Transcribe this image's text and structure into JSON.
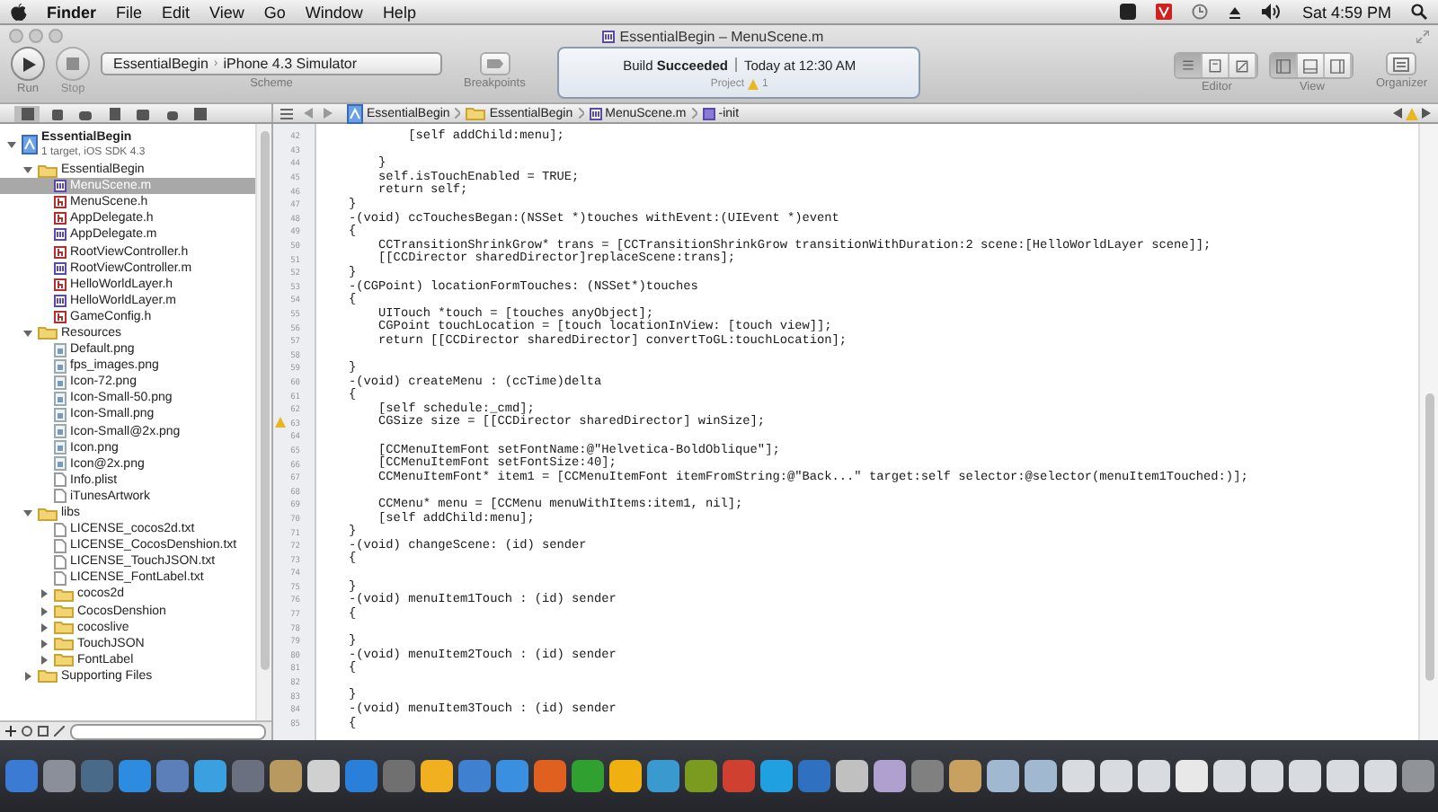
{
  "menu_bar": {
    "items": [
      {
        "label": "Finder",
        "bold": true
      },
      {
        "label": "File",
        "bold": false
      },
      {
        "label": "Edit",
        "bold": false
      },
      {
        "label": "View",
        "bold": false
      },
      {
        "label": "Go",
        "bold": false
      },
      {
        "label": "Window",
        "bold": false
      },
      {
        "label": "Help",
        "bold": false
      }
    ],
    "clock": "Sat 4:59 PM"
  },
  "window": {
    "title": "EssentialBegin – MenuScene.m"
  },
  "toolbar": {
    "run_label": "Run",
    "stop_label": "Stop",
    "stop_disabled": true,
    "scheme": {
      "project": "EssentialBegin",
      "separator": "›",
      "destination": "iPhone 4.3 Simulator",
      "label": "Scheme"
    },
    "breakpoints_label": "Breakpoints",
    "activity": {
      "status_prefix": "Build",
      "status": "Succeeded",
      "time": "Today at 12:30 AM",
      "project": "Project",
      "warnings": "1"
    },
    "editor": {
      "label": "Editor",
      "buttons": [
        {
          "selected": true
        },
        {
          "selected": false
        },
        {
          "selected": false
        }
      ]
    },
    "view": {
      "label": "View",
      "buttons": [
        {
          "selected": true
        },
        {
          "selected": false
        },
        {
          "selected": false
        }
      ]
    },
    "organizer_label": "Organizer"
  },
  "navigator_tabs": [
    {
      "selected": true
    },
    {
      "selected": false
    },
    {
      "selected": false
    },
    {
      "selected": false
    },
    {
      "selected": false
    },
    {
      "selected": false
    },
    {
      "selected": false
    }
  ],
  "jump_bar": {
    "crumbs": [
      {
        "label": "EssentialBegin",
        "kind": "project"
      },
      {
        "label": "EssentialBegin",
        "kind": "folder"
      },
      {
        "label": "MenuScene.m",
        "kind": "source"
      },
      {
        "label": "-init",
        "kind": "method"
      }
    ]
  },
  "navigator": {
    "items": [
      {
        "label": "EssentialBegin",
        "subtitle": "1 target, iOS SDK 4.3",
        "kind": "project",
        "selected": false,
        "expanded": true,
        "children": [
          {
            "label": "EssentialBegin",
            "kind": "folder",
            "selected": false,
            "expanded": true,
            "children": [
              {
                "label": "MenuScene.m",
                "kind": "source",
                "selected": true
              },
              {
                "label": "MenuScene.h",
                "kind": "header",
                "selected": false
              },
              {
                "label": "AppDelegate.h",
                "kind": "header",
                "selected": false
              },
              {
                "label": "AppDelegate.m",
                "kind": "source",
                "selected": false
              },
              {
                "label": "RootViewController.h",
                "kind": "header",
                "selected": false
              },
              {
                "label": "RootViewController.m",
                "kind": "source",
                "selected": false
              },
              {
                "label": "HelloWorldLayer.h",
                "kind": "header",
                "selected": false
              },
              {
                "label": "HelloWorldLayer.m",
                "kind": "source",
                "selected": false
              },
              {
                "label": "GameConfig.h",
                "kind": "header",
                "selected": false
              }
            ]
          },
          {
            "label": "Resources",
            "kind": "folder",
            "selected": false,
            "expanded": true,
            "children": [
              {
                "label": "Default.png",
                "kind": "image",
                "selected": false
              },
              {
                "label": "fps_images.png",
                "kind": "image",
                "selected": false
              },
              {
                "label": "Icon-72.png",
                "kind": "image",
                "selected": false
              },
              {
                "label": "Icon-Small-50.png",
                "kind": "image",
                "selected": false
              },
              {
                "label": "Icon-Small.png",
                "kind": "image",
                "selected": false
              },
              {
                "label": "Icon-Small@2x.png",
                "kind": "image",
                "selected": false
              },
              {
                "label": "Icon.png",
                "kind": "image",
                "selected": false
              },
              {
                "label": "Icon@2x.png",
                "kind": "image",
                "selected": false
              },
              {
                "label": "Info.plist",
                "kind": "document",
                "selected": false
              },
              {
                "label": "iTunesArtwork",
                "kind": "document",
                "selected": false
              }
            ]
          },
          {
            "label": "libs",
            "kind": "folder",
            "selected": false,
            "expanded": true,
            "children": [
              {
                "label": "LICENSE_cocos2d.txt",
                "kind": "document",
                "selected": false
              },
              {
                "label": "LICENSE_CocosDenshion.txt",
                "kind": "document",
                "selected": false
              },
              {
                "label": "LICENSE_TouchJSON.txt",
                "kind": "document",
                "selected": false
              },
              {
                "label": "LICENSE_FontLabel.txt",
                "kind": "document",
                "selected": false
              },
              {
                "label": "cocos2d",
                "kind": "folder",
                "selected": false,
                "expanded": false
              },
              {
                "label": "CocosDenshion",
                "kind": "folder",
                "selected": false,
                "expanded": false
              },
              {
                "label": "cocoslive",
                "kind": "folder",
                "selected": false,
                "expanded": false
              },
              {
                "label": "TouchJSON",
                "kind": "folder",
                "selected": false,
                "expanded": false
              },
              {
                "label": "FontLabel",
                "kind": "folder",
                "selected": false,
                "expanded": false
              }
            ]
          },
          {
            "label": "Supporting Files",
            "kind": "folder",
            "selected": false,
            "expanded": false
          }
        ]
      }
    ]
  },
  "code": {
    "lines": [
      {
        "number": "42",
        "text": "        [self addChild:menu];",
        "warning": false
      },
      {
        "number": "43",
        "warning": false
      },
      {
        "number": "44",
        "text": "    }",
        "warning": false
      },
      {
        "number": "45",
        "text": "    self.isTouchEnabled = TRUE;",
        "warning": false
      },
      {
        "number": "46",
        "text": "    return self;",
        "warning": false
      },
      {
        "number": "47",
        "text": "}",
        "warning": false
      },
      {
        "number": "48",
        "text": "-(void) ccTouchesBegan:(NSSet *)touches withEvent:(UIEvent *)event",
        "warning": false
      },
      {
        "number": "49",
        "text": "{",
        "warning": false
      },
      {
        "number": "50",
        "text": "    CCTransitionShrinkGrow* trans = [CCTransitionShrinkGrow transitionWithDuration:2 scene:[HelloWorldLayer scene]];",
        "warning": false
      },
      {
        "number": "51",
        "text": "    [[CCDirector sharedDirector]replaceScene:trans];",
        "warning": false
      },
      {
        "number": "52",
        "text": "}",
        "warning": false
      },
      {
        "number": "53",
        "text": "-(CGPoint) locationFormTouches: (NSSet*)touches",
        "warning": false
      },
      {
        "number": "54",
        "text": "{",
        "warning": false
      },
      {
        "number": "55",
        "text": "    UITouch *touch = [touches anyObject];",
        "warning": false
      },
      {
        "number": "56",
        "text": "    CGPoint touchLocation = [touch locationInView: [touch view]];",
        "warning": false
      },
      {
        "number": "57",
        "text": "    return [[CCDirector sharedDirector] convertToGL:touchLocation];",
        "warning": false
      },
      {
        "number": "58",
        "warning": false
      },
      {
        "number": "59",
        "text": "}",
        "warning": false
      },
      {
        "number": "60",
        "text": "-(void) createMenu : (ccTime)delta",
        "warning": false
      },
      {
        "number": "61",
        "text": "{",
        "warning": false
      },
      {
        "number": "62",
        "text": "    [self schedule:_cmd];",
        "warning": false
      },
      {
        "number": "63",
        "text": "    CGSize size = [[CCDirector sharedDirector] winSize];",
        "warning": true
      },
      {
        "number": "64",
        "warning": false
      },
      {
        "number": "65",
        "text": "    [CCMenuItemFont setFontName:@\"Helvetica-BoldOblique\"];",
        "warning": false
      },
      {
        "number": "66",
        "text": "    [CCMenuItemFont setFontSize:40];",
        "warning": false
      },
      {
        "number": "67",
        "text": "    CCMenuItemFont* item1 = [CCMenuItemFont itemFromString:@\"Back...\" target:self selector:@selector(menuItem1Touched:)];",
        "warning": false
      },
      {
        "number": "68",
        "warning": false
      },
      {
        "number": "69",
        "text": "    CCMenu* menu = [CCMenu menuWithItems:item1, nil];",
        "warning": false
      },
      {
        "number": "70",
        "text": "    [self addChild:menu];",
        "warning": false
      },
      {
        "number": "71",
        "text": "}",
        "warning": false
      },
      {
        "number": "72",
        "text": "-(void) changeScene: (id) sender",
        "warning": false
      },
      {
        "number": "73",
        "text": "{",
        "warning": false
      },
      {
        "number": "74",
        "warning": false
      },
      {
        "number": "75",
        "text": "}",
        "warning": false
      },
      {
        "number": "76",
        "text": "-(void) menuItem1Touch : (id) sender",
        "warning": false
      },
      {
        "number": "77",
        "text": "{",
        "warning": false
      },
      {
        "number": "78",
        "warning": false
      },
      {
        "number": "79",
        "text": "}",
        "warning": false
      },
      {
        "number": "80",
        "text": "-(void) menuItem2Touch : (id) sender",
        "warning": false
      },
      {
        "number": "81",
        "text": "{",
        "warning": false
      },
      {
        "number": "82",
        "warning": false
      },
      {
        "number": "83",
        "text": "}",
        "warning": false
      },
      {
        "number": "84",
        "text": "-(void) menuItem3Touch : (id) sender",
        "warning": false
      },
      {
        "number": "85",
        "text": "{",
        "warning": false
      }
    ]
  }
}
